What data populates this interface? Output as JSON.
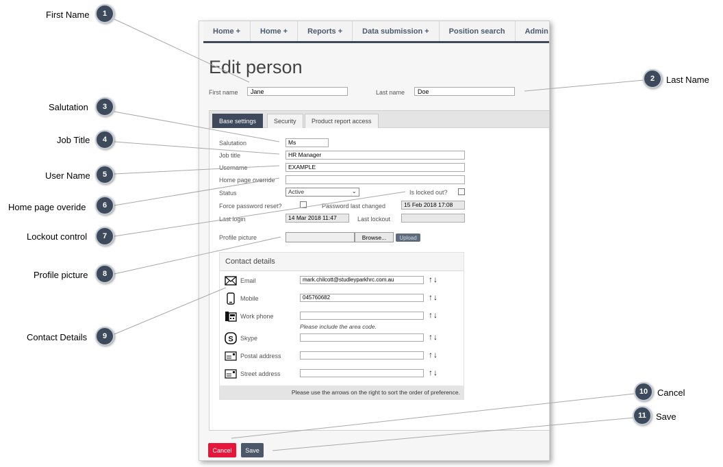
{
  "nav": {
    "items": [
      "Home +",
      "Home +",
      "Reports +",
      "Data submission +",
      "Position search",
      "Admin +"
    ]
  },
  "page_title": "Edit person",
  "first_name": {
    "label": "First name",
    "value": "Jane"
  },
  "last_name": {
    "label": "Last name",
    "value": "Doe"
  },
  "tabs": [
    "Base settings",
    "Security",
    "Product report access"
  ],
  "form": {
    "salutation": {
      "label": "Salutation",
      "value": "Ms"
    },
    "job_title": {
      "label": "Job title",
      "value": "HR Manager"
    },
    "username": {
      "label": "Username",
      "value": "EXAMPLE"
    },
    "home_page_override": {
      "label": "Home page override",
      "value": ""
    },
    "status": {
      "label": "Status",
      "value": "Active"
    },
    "is_locked_out": {
      "label": "Is locked out?"
    },
    "force_password_reset": {
      "label": "Force password reset?"
    },
    "password_last_changed": {
      "label": "Password last changed",
      "value": "15 Feb 2018 17:08"
    },
    "last_login": {
      "label": "Last login",
      "value": "14 Mar 2018 11:47"
    },
    "last_lockout": {
      "label": "Last lockout",
      "value": ""
    },
    "profile_picture": {
      "label": "Profile picture",
      "browse_label": "Browse...",
      "upload_label": "Upload"
    }
  },
  "contact": {
    "title": "Contact details",
    "rows": [
      {
        "icon": "envelope-icon",
        "label": "Email",
        "value": "mark.chilcott@studleyparkhrc.com.au"
      },
      {
        "icon": "mobile-phone-icon",
        "label": "Mobile",
        "value": "045760682"
      },
      {
        "icon": "desk-phone-icon",
        "label": "Work phone",
        "value": "",
        "hint": "Please include the area code."
      },
      {
        "icon": "skype-icon",
        "label": "Skype",
        "value": ""
      },
      {
        "icon": "address-card-icon",
        "label": "Postal address",
        "value": ""
      },
      {
        "icon": "address-card-icon",
        "label": "Street address",
        "value": ""
      }
    ],
    "arrows": "↑↓",
    "footer": "Please use the arrows on the right to sort the order of preference."
  },
  "buttons": {
    "cancel": "Cancel",
    "save": "Save"
  },
  "callouts": [
    {
      "num": "1",
      "label": "First Name"
    },
    {
      "num": "2",
      "label": "Last Name"
    },
    {
      "num": "3",
      "label": "Salutation"
    },
    {
      "num": "4",
      "label": "Job Title"
    },
    {
      "num": "5",
      "label": "User Name"
    },
    {
      "num": "6",
      "label": "Home page overide"
    },
    {
      "num": "7",
      "label": "Lockout control"
    },
    {
      "num": "8",
      "label": "Profile picture"
    },
    {
      "num": "9",
      "label": "Contact Details"
    },
    {
      "num": "10",
      "label": "Cancel"
    },
    {
      "num": "11",
      "label": "Save"
    }
  ],
  "colors": {
    "accent": "#3d4a5c",
    "cancel": "#e4163c",
    "save": "#4a5869"
  }
}
